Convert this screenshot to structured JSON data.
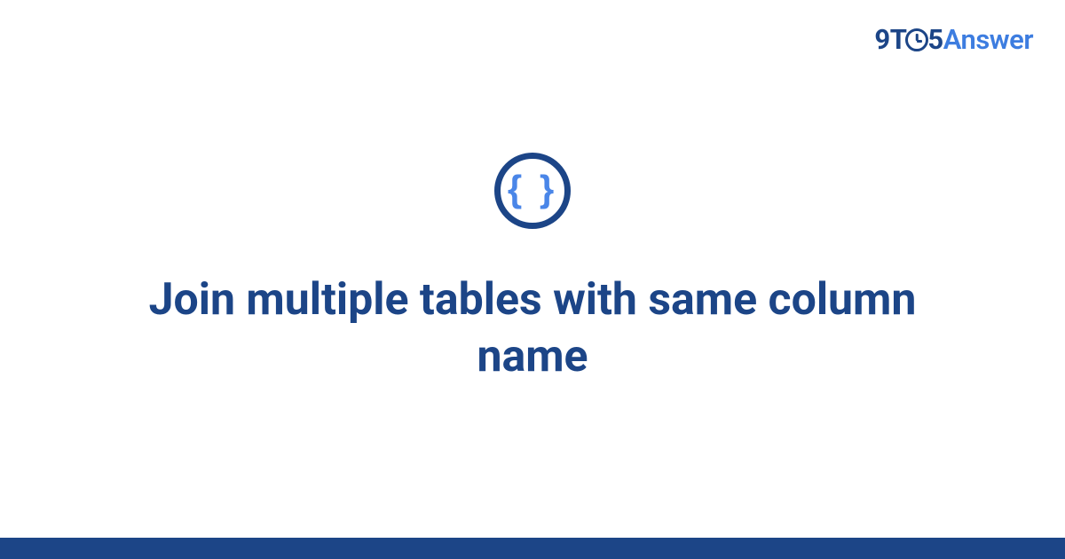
{
  "brand": {
    "part1": "9",
    "part2": "T",
    "part3": "5",
    "part4": "Answer"
  },
  "icon": {
    "glyph": "{ }"
  },
  "main": {
    "title": "Join multiple tables with same column name"
  }
}
